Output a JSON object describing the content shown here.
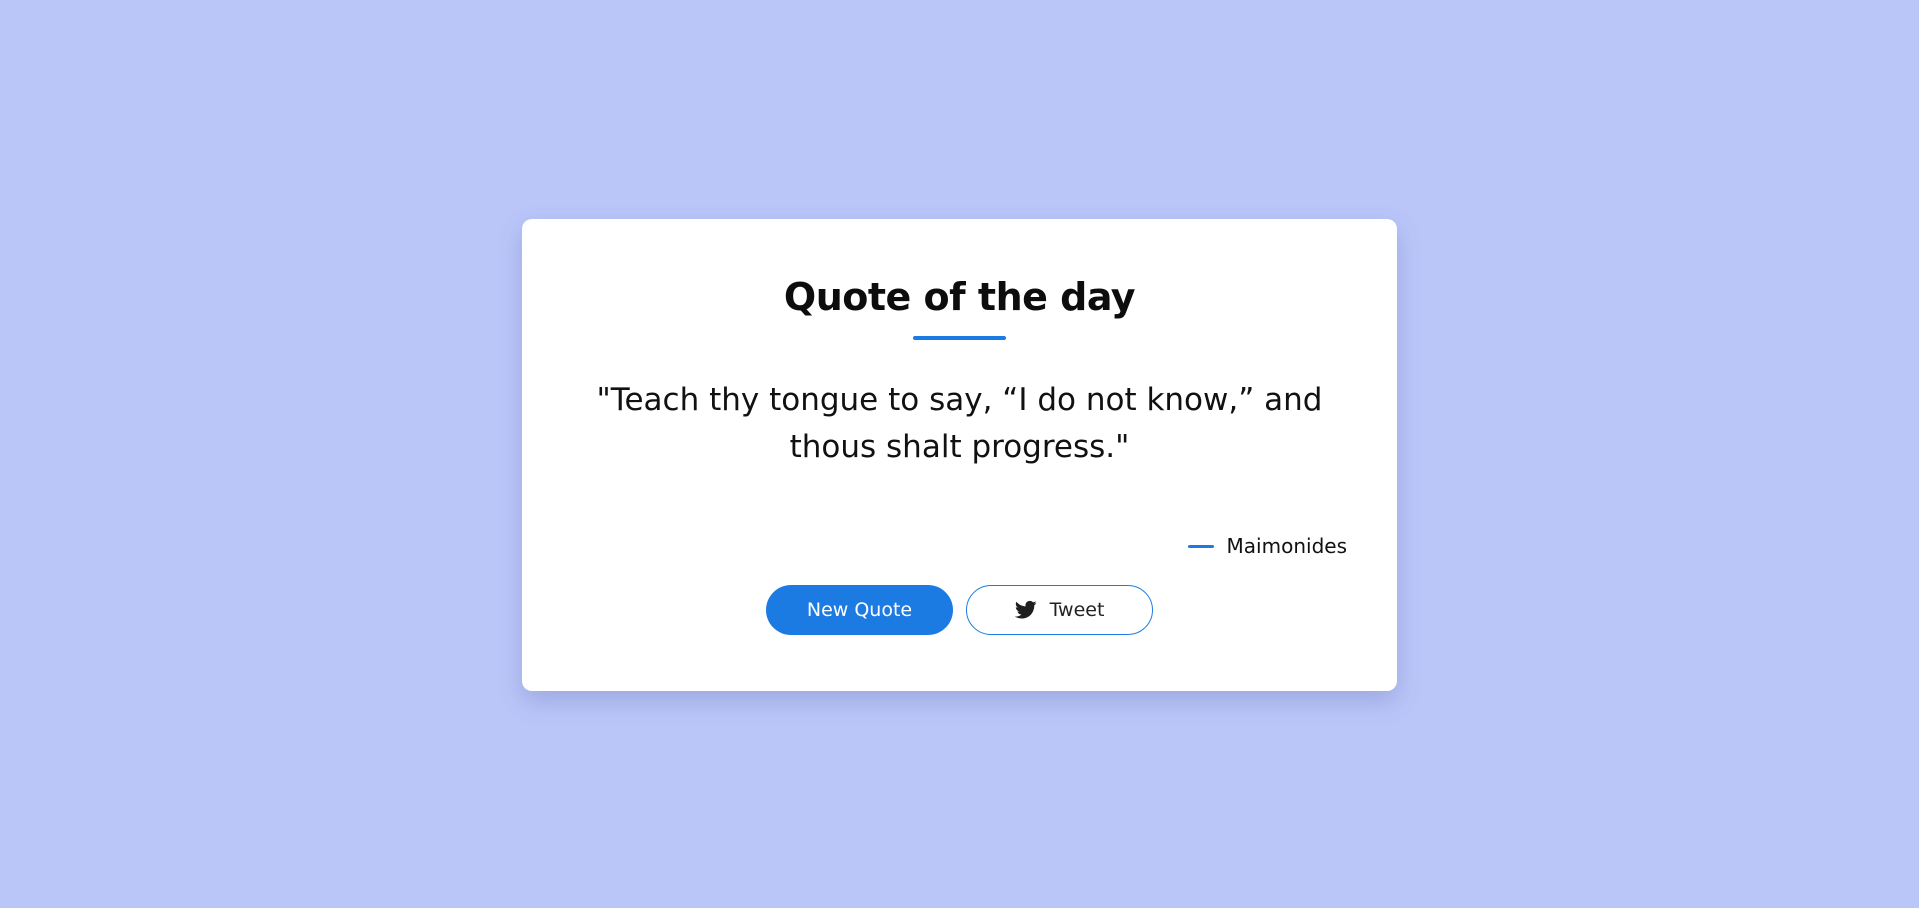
{
  "colors": {
    "background": "#bac6f8",
    "card": "#ffffff",
    "accent": "#1b7be3",
    "text": "#111111"
  },
  "card": {
    "title": "Quote of the day",
    "quote": "\"Teach thy tongue to say, “I do not know,” and thous shalt progress.\"",
    "author": "Maimonides"
  },
  "buttons": {
    "new_quote_label": "New Quote",
    "tweet_label": "Tweet",
    "tweet_icon": "twitter-bird-icon"
  }
}
